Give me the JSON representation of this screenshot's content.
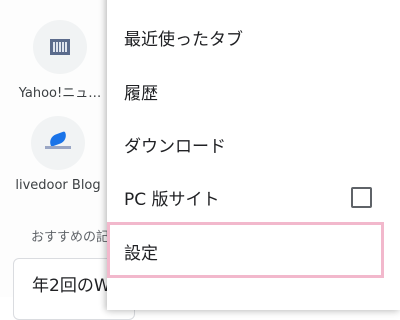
{
  "shortcuts": [
    {
      "label": "Yahoo!ニュ…",
      "icon": "yahoo-news-icon"
    },
    {
      "label": "livedoor Blog",
      "icon": "livedoor-blog-icon"
    }
  ],
  "recommended": {
    "label": "おすすめの記",
    "card_title": "年2回のW"
  },
  "menu": {
    "items": [
      {
        "label": "最近使ったタブ"
      },
      {
        "label": "履歴"
      },
      {
        "label": "ダウンロード"
      },
      {
        "label": "PC 版サイト",
        "checkbox": false
      },
      {
        "label": "設定",
        "highlighted": true
      }
    ]
  },
  "colors": {
    "highlight_border": "#f2b8cc",
    "menu_background": "#ffffff"
  }
}
